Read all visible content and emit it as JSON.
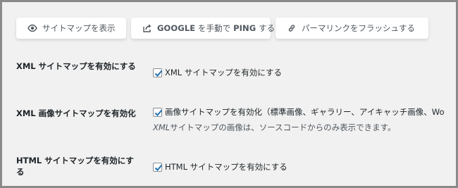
{
  "toolbar": {
    "view_sitemap": {
      "label": "サイトマップを表示",
      "icon": "eye-icon"
    },
    "ping_google": {
      "label_en": "GOOGLE",
      "label_jp": " を手動で ",
      "label_en2": "PING",
      "label_jp2": " する",
      "icon": "share-icon"
    },
    "flush_permalinks": {
      "label": "パーマリンクをフラッシュする",
      "icon": "link-icon"
    }
  },
  "settings": {
    "xml_sitemap": {
      "label": "XML サイトマップを有効にする",
      "checkbox_label": "XML サイトマップを有効にする",
      "checked": true
    },
    "image_sitemap": {
      "label": "XML 画像サイトマップを有効化",
      "checkbox_label": "画像サイトマップを有効化（標準画像、ギャラリー、アイキャッチ画像、Wo",
      "checked": true,
      "description_em": "XML",
      "description": "サイトマップの画像は、ソースコードからのみ表示できます。"
    },
    "html_sitemap": {
      "label": "HTML サイトマップを有効にする",
      "checkbox_label": "HTML サイトマップを有効にする",
      "checked": true
    }
  },
  "colors": {
    "background": "#f1f1f1",
    "button_bg": "#ffffff",
    "text": "#1d2327",
    "muted_text": "#50575e",
    "checkmark": "#2271b1"
  }
}
